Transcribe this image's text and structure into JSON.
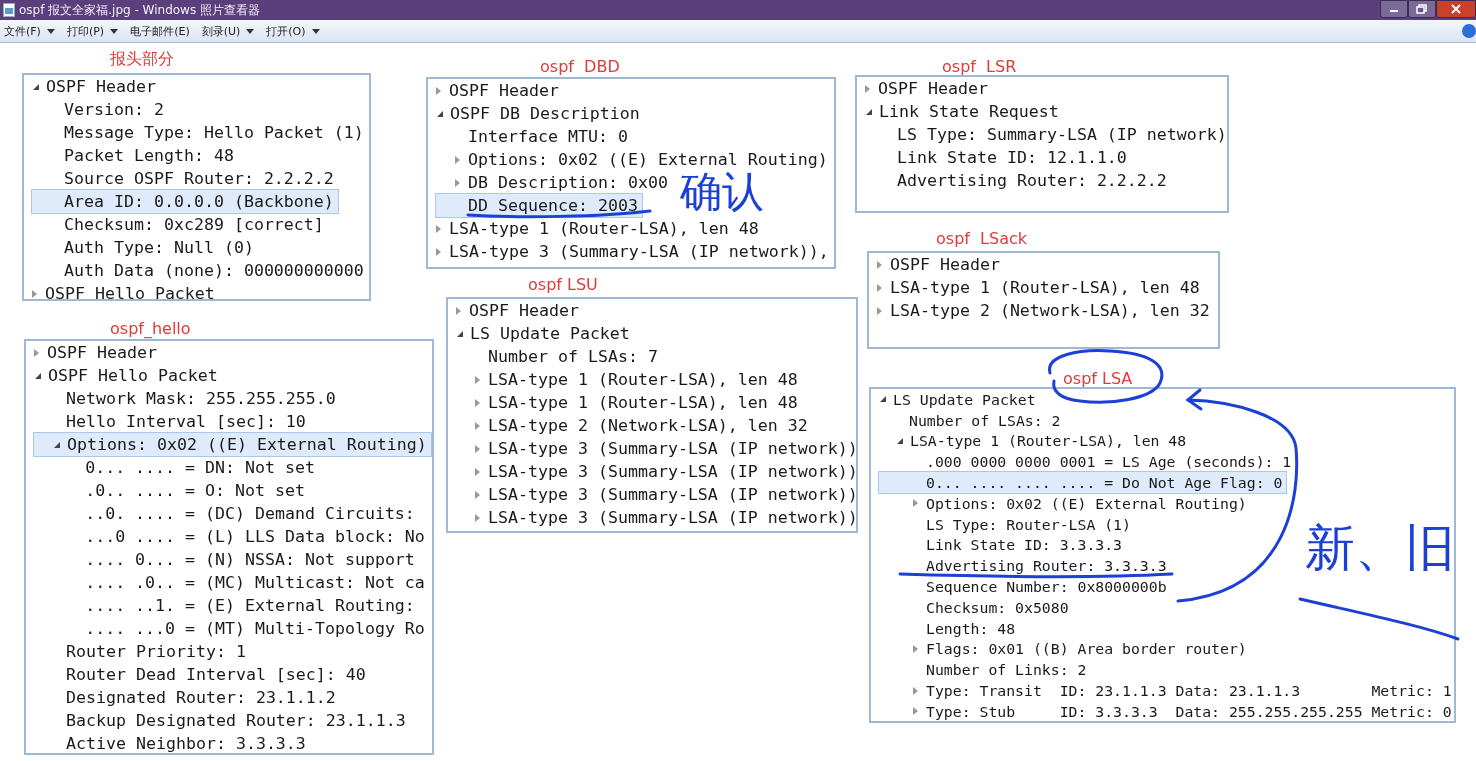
{
  "window": {
    "title": "ospf 报文全家福.jpg - Windows 照片查看器"
  },
  "menu": [
    {
      "label": "文件(F)",
      "dropdown": true
    },
    {
      "label": "打印(P)",
      "dropdown": true
    },
    {
      "label": "电子邮件(E)",
      "dropdown": false
    },
    {
      "label": "刻录(U)",
      "dropdown": true
    },
    {
      "label": "打开(O)",
      "dropdown": true
    }
  ],
  "panels": [
    {
      "label": "报头部分",
      "tree": [
        {
          "text": "OSPF Header",
          "expanded": true,
          "selected": false,
          "children": [
            {
              "text": "Version: 2",
              "selected": false
            },
            {
              "text": "Message Type: Hello Packet (1)",
              "selected": false
            },
            {
              "text": "Packet Length: 48",
              "selected": false
            },
            {
              "text": "Source OSPF Router: 2.2.2.2",
              "selected": false
            },
            {
              "text": "Area ID: 0.0.0.0 (Backbone)",
              "selected": true
            },
            {
              "text": "Checksum: 0xc289 [correct]",
              "selected": false
            },
            {
              "text": "Auth Type: Null (0)",
              "selected": false
            },
            {
              "text": "Auth Data (none): 000000000000",
              "selected": false
            }
          ]
        },
        {
          "text": "OSPF Hello Packet",
          "expanded": false,
          "selected": false
        }
      ]
    },
    {
      "label": "ospf  DBD",
      "tree": [
        {
          "text": "OSPF Header",
          "expanded": false,
          "selected": false
        },
        {
          "text": "OSPF DB Description",
          "expanded": true,
          "selected": false,
          "children": [
            {
              "text": "Interface MTU: 0",
              "selected": false
            },
            {
              "text": "Options: 0x02 ((E) External Routing)",
              "expanded": false,
              "selected": false
            },
            {
              "text": "DB Description: 0x00",
              "expanded": false,
              "selected": false
            },
            {
              "text": "DD Sequence: 2003",
              "selected": true
            }
          ]
        },
        {
          "text": "LSA-type 1 (Router-LSA), len 48",
          "expanded": false,
          "selected": false
        },
        {
          "text": "LSA-type 3 (Summary-LSA (IP network)),",
          "expanded": false,
          "selected": false
        }
      ]
    },
    {
      "label": "ospf  LSR",
      "tree": [
        {
          "text": "OSPF Header",
          "expanded": false,
          "selected": false
        },
        {
          "text": "Link State Request",
          "expanded": true,
          "selected": false,
          "children": [
            {
              "text": "LS Type: Summary-LSA (IP network)",
              "selected": false
            },
            {
              "text": "Link State ID: 12.1.1.0",
              "selected": false
            },
            {
              "text": "Advertising Router: 2.2.2.2",
              "selected": false
            }
          ]
        }
      ]
    },
    {
      "label": "ospf_hello",
      "tree": [
        {
          "text": "OSPF Header",
          "expanded": false,
          "selected": false
        },
        {
          "text": "OSPF Hello Packet",
          "expanded": true,
          "selected": false,
          "children": [
            {
              "text": "Network Mask: 255.255.255.0",
              "selected": false
            },
            {
              "text": "Hello Interval [sec]: 10",
              "selected": false
            },
            {
              "text": "Options: 0x02 ((E) External Routing)",
              "expanded": true,
              "selected": true,
              "children": [
                {
                  "text": "0... .... = DN: Not set",
                  "selected": false
                },
                {
                  "text": ".0.. .... = O: Not set",
                  "selected": false
                },
                {
                  "text": "..0. .... = (DC) Demand Circuits:",
                  "selected": false
                },
                {
                  "text": "...0 .... = (L) LLS Data block: No",
                  "selected": false
                },
                {
                  "text": ".... 0... = (N) NSSA: Not support",
                  "selected": false
                },
                {
                  "text": ".... .0.. = (MC) Multicast: Not ca",
                  "selected": false
                },
                {
                  "text": ".... ..1. = (E) External Routing:",
                  "selected": false
                },
                {
                  "text": ".... ...0 = (MT) Multi-Topology Ro",
                  "selected": false
                }
              ]
            },
            {
              "text": "Router Priority: 1",
              "selected": false
            },
            {
              "text": "Router Dead Interval [sec]: 40",
              "selected": false
            },
            {
              "text": "Designated Router: 23.1.1.2",
              "selected": false
            },
            {
              "text": "Backup Designated Router: 23.1.1.3",
              "selected": false
            },
            {
              "text": "Active Neighbor: 3.3.3.3",
              "selected": false
            }
          ]
        }
      ]
    },
    {
      "label": "ospf LSU",
      "tree": [
        {
          "text": "OSPF Header",
          "expanded": false,
          "selected": false
        },
        {
          "text": "LS Update Packet",
          "expanded": true,
          "selected": false,
          "children": [
            {
              "text": "Number of LSAs: 7",
              "selected": false
            },
            {
              "text": "LSA-type 1 (Router-LSA), len 48",
              "expanded": false,
              "selected": false
            },
            {
              "text": "LSA-type 1 (Router-LSA), len 48",
              "expanded": false,
              "selected": false
            },
            {
              "text": "LSA-type 2 (Network-LSA), len 32",
              "expanded": false,
              "selected": false
            },
            {
              "text": "LSA-type 3 (Summary-LSA (IP network))",
              "expanded": false,
              "selected": false
            },
            {
              "text": "LSA-type 3 (Summary-LSA (IP network))",
              "expanded": false,
              "selected": false
            },
            {
              "text": "LSA-type 3 (Summary-LSA (IP network))",
              "expanded": false,
              "selected": false
            },
            {
              "text": "LSA-type 3 (Summary-LSA (IP network))",
              "expanded": false,
              "selected": false
            }
          ]
        }
      ]
    },
    {
      "label": "ospf  LSack",
      "tree": [
        {
          "text": "OSPF Header",
          "expanded": false,
          "selected": false
        },
        {
          "text": "LSA-type 1 (Router-LSA), len 48",
          "expanded": false,
          "selected": false
        },
        {
          "text": "LSA-type 2 (Network-LSA), len 32",
          "expanded": false,
          "selected": false
        }
      ]
    },
    {
      "label": "ospf LSA",
      "tree": [
        {
          "text": "LS Update Packet",
          "expanded": true,
          "selected": false,
          "children": [
            {
              "text": "Number of LSAs: 2",
              "selected": false
            },
            {
              "text": "LSA-type 1 (Router-LSA), len 48",
              "expanded": true,
              "selected": false,
              "children": [
                {
                  "text": ".000 0000 0000 0001 = LS Age (seconds): 1",
                  "selected": false
                },
                {
                  "text": "0... .... .... .... = Do Not Age Flag: 0",
                  "selected": true
                },
                {
                  "text": "Options: 0x02 ((E) External Routing)",
                  "expanded": false,
                  "selected": false
                },
                {
                  "text": "LS Type: Router-LSA (1)",
                  "selected": false
                },
                {
                  "text": "Link State ID: 3.3.3.3",
                  "selected": false
                },
                {
                  "text": "Advertising Router: 3.3.3.3",
                  "selected": false
                },
                {
                  "text": "Sequence Number: 0x8000000b",
                  "selected": false
                },
                {
                  "text": "Checksum: 0x5080",
                  "selected": false
                },
                {
                  "text": "Length: 48",
                  "selected": false
                },
                {
                  "text": "Flags: 0x01 ((B) Area border router)",
                  "expanded": false,
                  "selected": false
                },
                {
                  "text": "Number of Links: 2",
                  "selected": false
                },
                {
                  "text": "Type: Transit  ID: 23.1.1.3 Data: 23.1.1.3        Metric: 1",
                  "expanded": false,
                  "selected": false
                },
                {
                  "text": "Type: Stub     ID: 3.3.3.3  Data: 255.255.255.255 Metric: 0",
                  "expanded": false,
                  "selected": false
                }
              ]
            }
          ]
        }
      ]
    }
  ],
  "annotations": [
    {
      "kind": "handwriting",
      "text": "确认"
    },
    {
      "kind": "handwriting",
      "text": "新、旧"
    }
  ]
}
